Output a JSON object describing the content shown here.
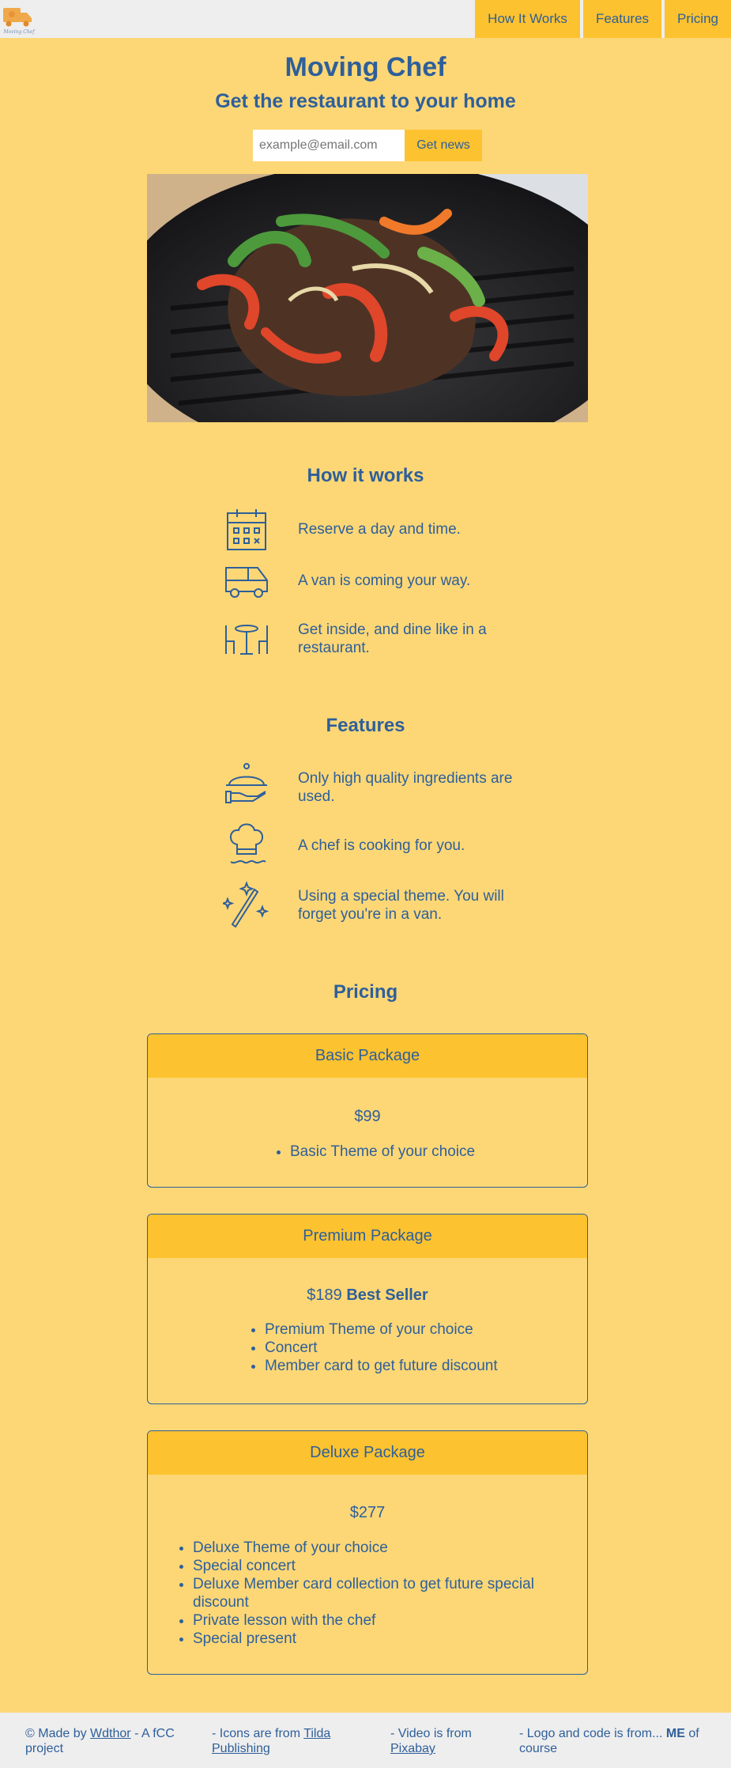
{
  "header": {
    "logo_text": "Moving Chef",
    "nav": [
      "How It Works",
      "Features",
      "Pricing"
    ]
  },
  "hero": {
    "title": "Moving Chef",
    "subtitle": "Get the restaurant to your home",
    "email_placeholder": "example@email.com",
    "button_label": "Get news"
  },
  "how_it_works": {
    "title": "How it works",
    "items": [
      {
        "icon": "calendar-icon",
        "text": "Reserve a day and time."
      },
      {
        "icon": "van-icon",
        "text": "A van is coming your way."
      },
      {
        "icon": "dining-table-icon",
        "text": "Get inside, and dine like in a restaurant."
      }
    ]
  },
  "features": {
    "title": "Features",
    "items": [
      {
        "icon": "cloche-icon",
        "text": "Only high quality ingredients are used."
      },
      {
        "icon": "chef-hat-icon",
        "text": "A chef is cooking for you."
      },
      {
        "icon": "magic-wand-icon",
        "text": "Using a special theme. You will forget you're in a van."
      }
    ]
  },
  "pricing": {
    "title": "Pricing",
    "packages": [
      {
        "name": "Basic Package",
        "price": "$99",
        "badge": "",
        "items": [
          "Basic Theme of your choice"
        ]
      },
      {
        "name": "Premium Package",
        "price": "$189",
        "badge": "Best Seller",
        "items": [
          "Premium Theme of your choice",
          "Concert",
          "Member card to get future discount"
        ]
      },
      {
        "name": "Deluxe Package",
        "price": "$277",
        "badge": "",
        "items": [
          "Deluxe Theme of your choice",
          "Special concert",
          "Deluxe Member card collection to get future special discount",
          "Private lesson with the chef",
          "Special present"
        ]
      }
    ]
  },
  "footer": {
    "col1_prefix": "© Made by ",
    "col1_link": "Wdthor",
    "col1_suffix": " - A fCC project",
    "col2_prefix": "- Icons are from ",
    "col2_link": "Tilda Publishing",
    "col3_prefix": "- Video is from ",
    "col3_link": "Pixabay",
    "col4_prefix": "- Logo and code is from... ",
    "col4_bold": "ME",
    "col4_suffix": " of course"
  },
  "colors": {
    "background": "#fdd776",
    "accent": "#fdc22f",
    "text": "#2e5f9a",
    "header_bg": "#eeeeee"
  }
}
